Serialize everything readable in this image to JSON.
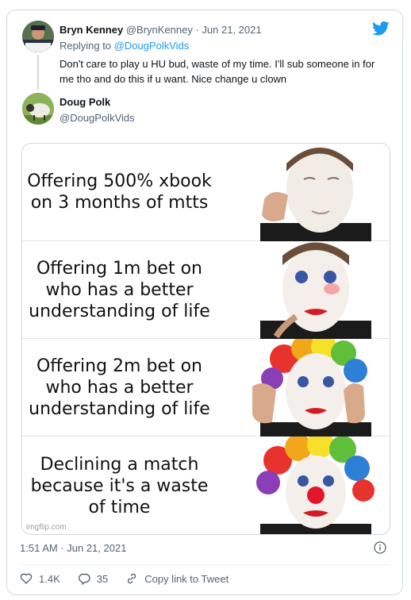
{
  "reply": {
    "name": "Bryn Kenney",
    "handle": "@BrynKenney",
    "date": " · Jun 21, 2021",
    "replying_prefix": "Replying to ",
    "replying_to": "@DougPolkVids",
    "text": "Don't care to play u HU bud, waste of my time.  I'll sub someone in for me tho and do this if u want.  Nice change u clown"
  },
  "main": {
    "name": "Doug Polk",
    "handle": "@DougPolkVids"
  },
  "meme": {
    "panels": [
      {
        "text": "Offering 500% xbook on 3 months of mtts"
      },
      {
        "text": "Offering 1m bet on who has a better understanding of life"
      },
      {
        "text": "Offering 2m bet on who has a better understanding of life"
      },
      {
        "text": "Declining a match because it's a waste of time"
      }
    ],
    "watermark": "imgflip.com"
  },
  "timestamp": "1:51 AM · Jun 21, 2021",
  "actions": {
    "likes": "1.4K",
    "replies": "35",
    "copy_link": "Copy link to Tweet"
  },
  "icons": {
    "logo": "twitter-bird-icon",
    "info": "info-icon",
    "like": "heart-icon",
    "reply": "reply-icon",
    "link": "link-icon"
  },
  "colors": {
    "brand": "#1d9bf0",
    "secondary_text": "#536471",
    "border": "#cfd9de"
  }
}
